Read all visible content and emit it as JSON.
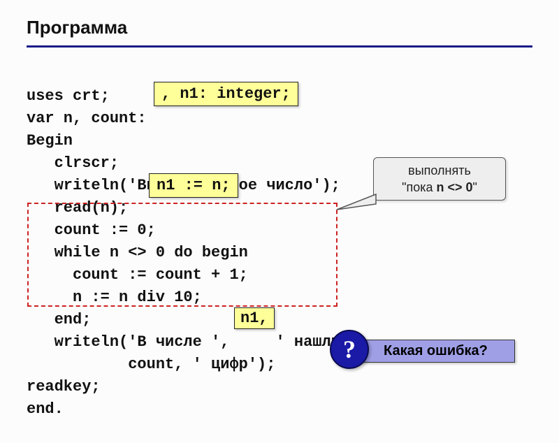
{
  "title": "Программа",
  "code": {
    "l1": "uses crt;",
    "l2": "var n, count:",
    "l3": "Begin",
    "l4": "   clrscr;",
    "l5": "   writeln('Введите целое число');",
    "l6": "   read(n);",
    "l7": "   count := 0;",
    "l8": "   while n <> 0 do begin",
    "l9": "     count := count + 1;",
    "l10": "     n := n div 10;",
    "l11": "   end;",
    "l12a": "   writeln('В числе ',",
    "l12b": "' нашли ',",
    "l13": "           count, ' цифр');",
    "l14": "readkey;",
    "l15": "end."
  },
  "callouts": {
    "c1": ", n1: integer;",
    "c2": "n1 := n;",
    "c3": "n1,"
  },
  "speech": {
    "line1": "выполнять",
    "line2a": "\"пока ",
    "line2b": "n <> 0",
    "line2c": "\""
  },
  "question": {
    "mark": "?",
    "text": "Какая ошибка?"
  }
}
